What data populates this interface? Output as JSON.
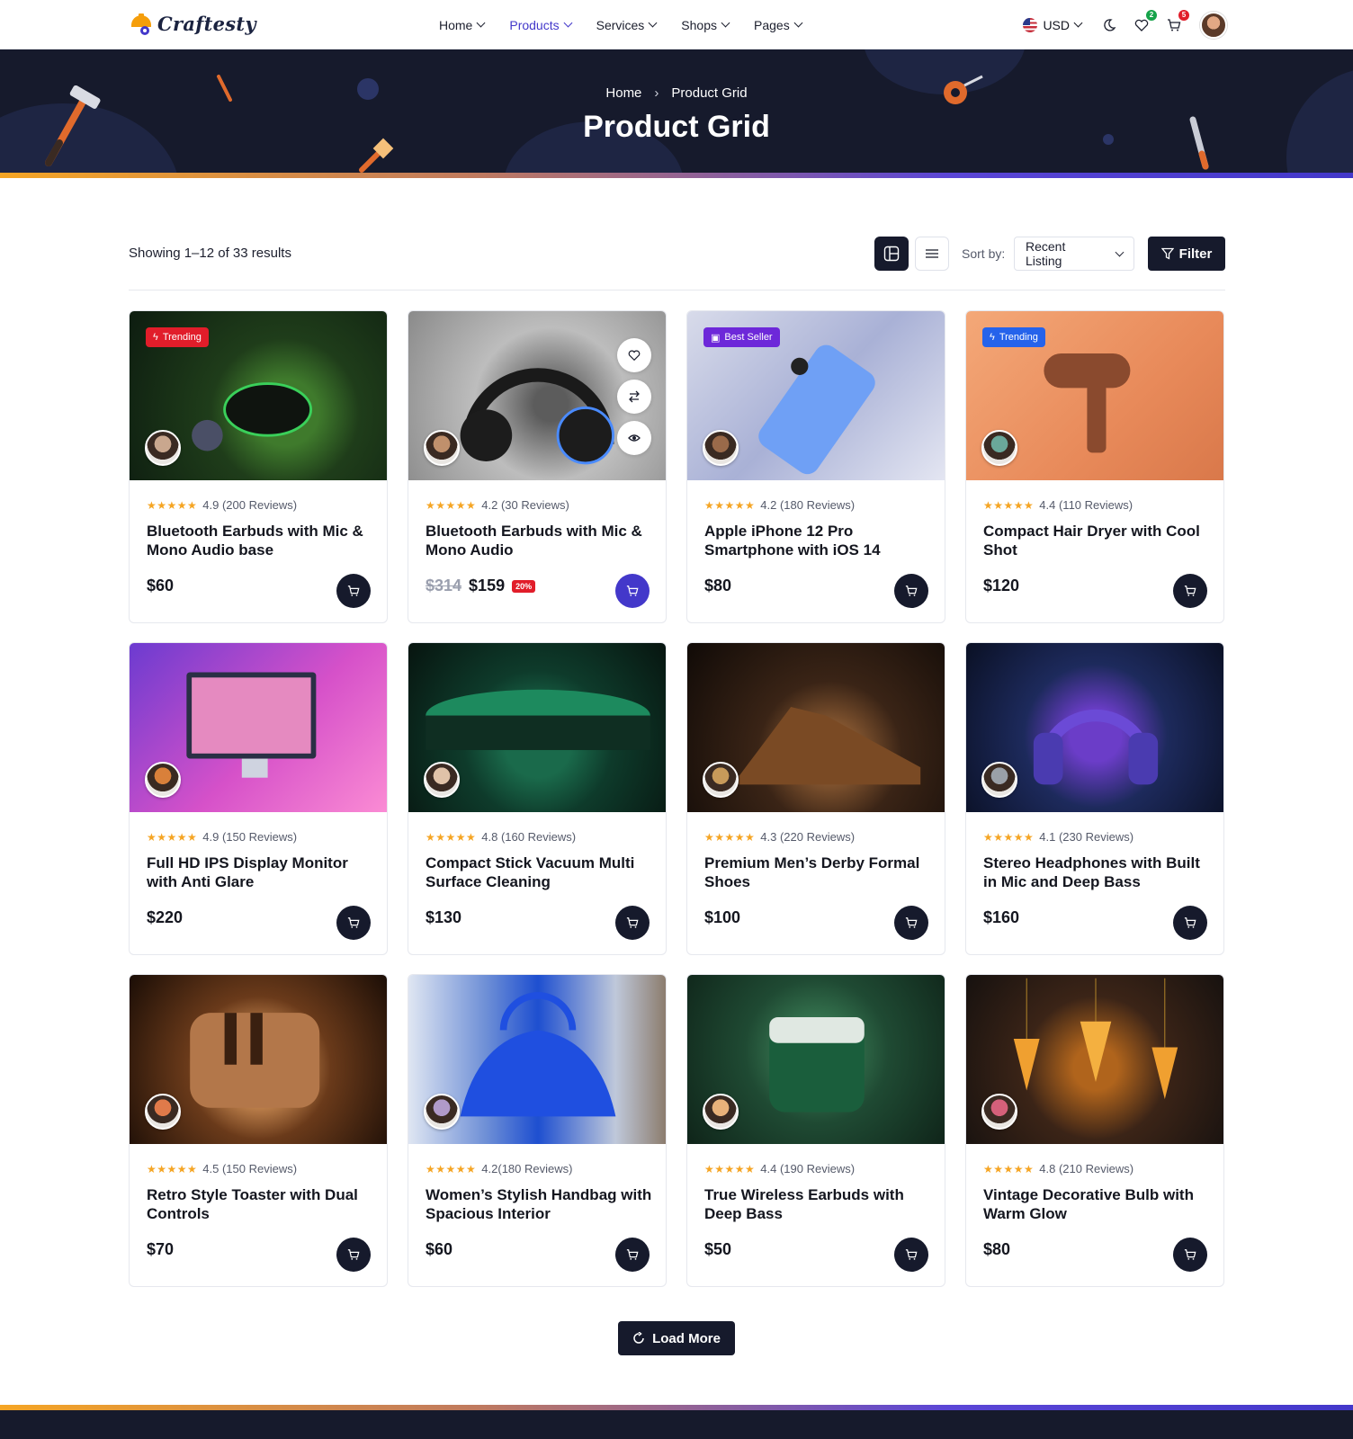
{
  "brand": {
    "name": "Craftesty"
  },
  "nav": [
    {
      "label": "Home",
      "active": false
    },
    {
      "label": "Products",
      "active": true
    },
    {
      "label": "Services",
      "active": false
    },
    {
      "label": "Shops",
      "active": false
    },
    {
      "label": "Pages",
      "active": false
    }
  ],
  "header_tools": {
    "currency": "USD",
    "wishlist_count": "2",
    "cart_count": "5"
  },
  "hero": {
    "breadcrumb_home": "Home",
    "breadcrumb_current": "Product Grid",
    "title": "Product Grid"
  },
  "toolbar": {
    "results": "Showing 1–12 of 33 results",
    "sort_label": "Sort by:",
    "sort_value": "Recent Listing",
    "filter_label": "Filter"
  },
  "colors": {
    "dark": "#161a2c",
    "accent": "#4338ca",
    "star": "#f5a524",
    "trending": "#e11d2a",
    "best_seller": "#6d28d9",
    "trending_blue": "#2563eb"
  },
  "products": [
    {
      "tag": "Trending",
      "rating": "4.9 (200 Reviews)",
      "title": "Bluetooth Earbuds with Mic & Mono Audio base",
      "price": "$60",
      "old_price": "",
      "discount": ""
    },
    {
      "tag": "",
      "rating": "4.2 (30 Reviews)",
      "title": "Bluetooth Earbuds with Mic & Mono Audio",
      "price": "$159",
      "old_price": "$314",
      "discount": "20%"
    },
    {
      "tag": "Best Seller",
      "rating": "4.2 (180 Reviews)",
      "title": "Apple iPhone 12 Pro Smartphone with iOS 14",
      "price": "$80",
      "old_price": "",
      "discount": ""
    },
    {
      "tag": "Trending",
      "rating": "4.4 (110 Reviews)",
      "title": "Compact Hair Dryer with Cool Shot",
      "price": "$120",
      "old_price": "",
      "discount": ""
    },
    {
      "tag": "",
      "rating": "4.9 (150 Reviews)",
      "title": "Full HD IPS Display Monitor with Anti Glare",
      "price": "$220",
      "old_price": "",
      "discount": ""
    },
    {
      "tag": "",
      "rating": "4.8 (160 Reviews)",
      "title": "Compact Stick Vacuum Multi Surface Cleaning",
      "price": "$130",
      "old_price": "",
      "discount": ""
    },
    {
      "tag": "",
      "rating": "4.3 (220 Reviews)",
      "title": "Premium Men’s Derby Formal Shoes",
      "price": "$100",
      "old_price": "",
      "discount": ""
    },
    {
      "tag": "",
      "rating": "4.1 (230 Reviews)",
      "title": "Stereo Headphones with Built in Mic and Deep Bass",
      "price": "$160",
      "old_price": "",
      "discount": ""
    },
    {
      "tag": "",
      "rating": "4.5 (150 Reviews)",
      "title": "Retro Style Toaster with Dual Controls",
      "price": "$70",
      "old_price": "",
      "discount": ""
    },
    {
      "tag": "",
      "rating": "4.2(180 Reviews)",
      "title": "Women’s Stylish Handbag with Spacious Interior",
      "price": "$60",
      "old_price": "",
      "discount": ""
    },
    {
      "tag": "",
      "rating": "4.4 (190 Reviews)",
      "title": "True Wireless Earbuds with Deep Bass",
      "price": "$50",
      "old_price": "",
      "discount": ""
    },
    {
      "tag": "",
      "rating": "4.8 (210 Reviews)",
      "title": "Vintage Decorative Bulb with Warm Glow",
      "price": "$80",
      "old_price": "",
      "discount": ""
    }
  ],
  "load_more": "Load More"
}
